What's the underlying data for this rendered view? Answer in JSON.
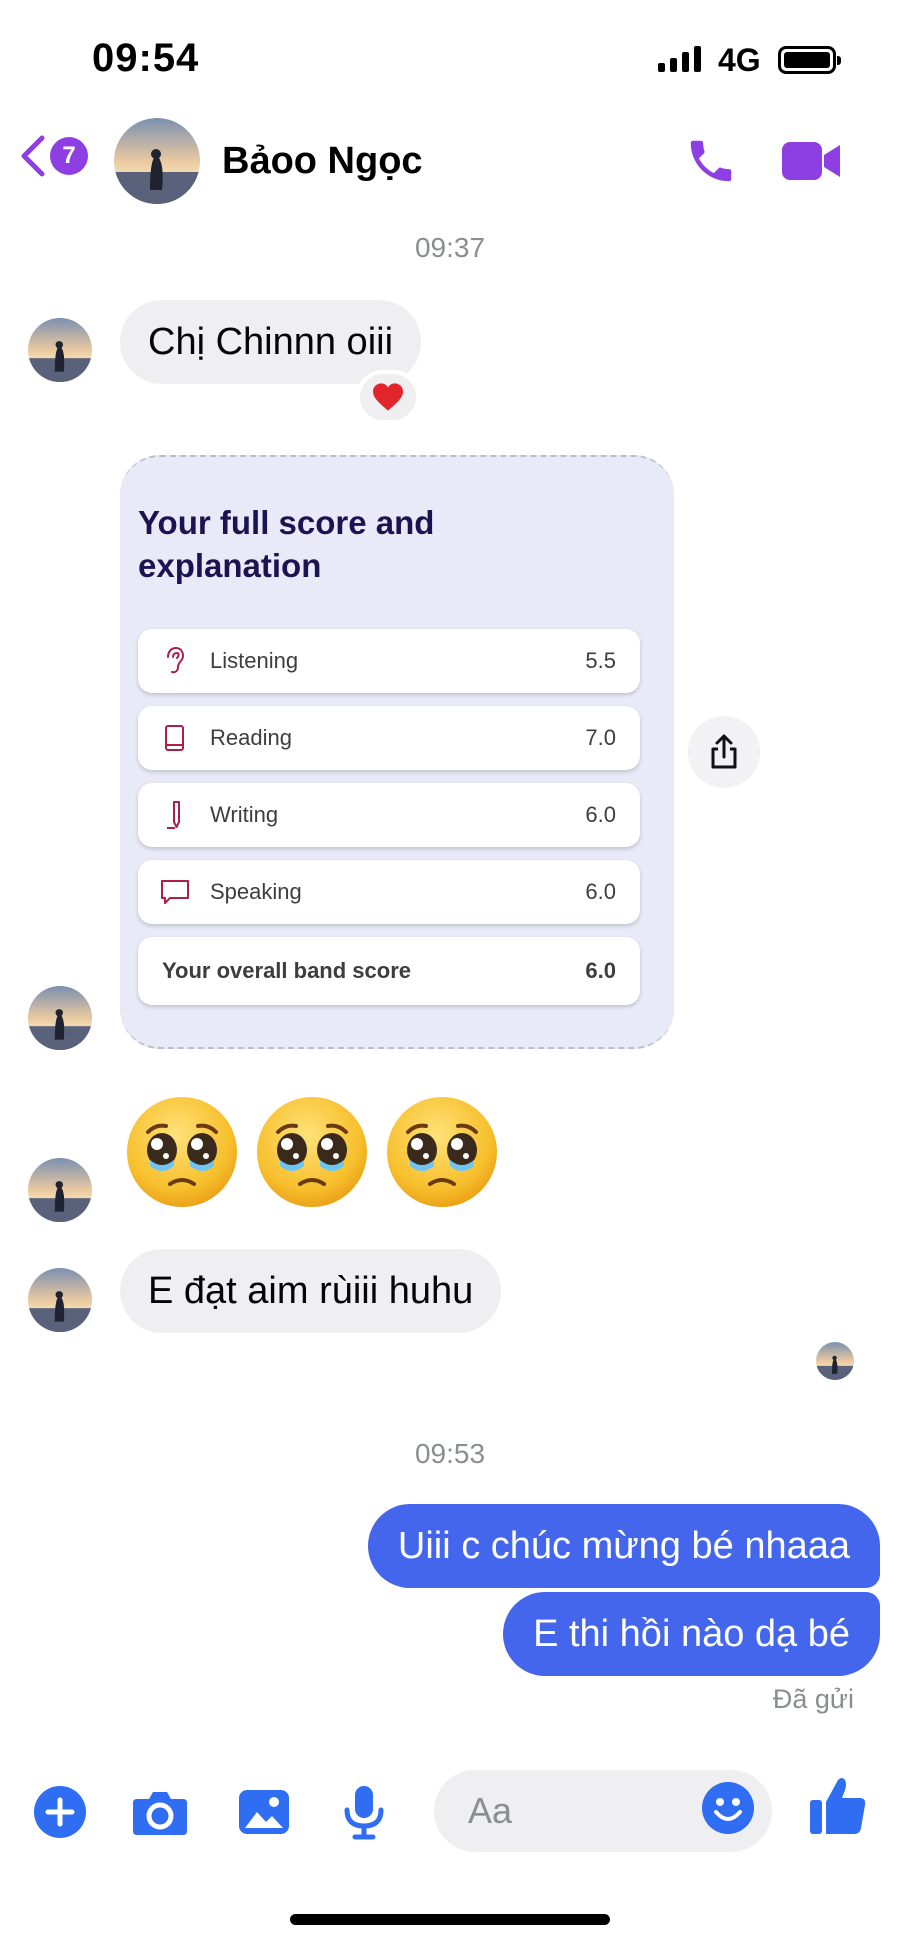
{
  "status_bar": {
    "time": "09:54",
    "network": "4G"
  },
  "header": {
    "back_count": "7",
    "contact_name": "Bảoo Ngọc",
    "icons": {
      "back": "chevron-left-icon",
      "call": "phone-icon",
      "video": "video-camera-icon"
    },
    "accent_color": "#8e3fe3"
  },
  "conversation": {
    "timestamp_1": "09:37",
    "message_1": "Chị Chinnn oiii",
    "reaction_1": "❤️",
    "score_card": {
      "title": "Your full score and explanation",
      "rows": [
        {
          "label": "Listening",
          "value": "5.5",
          "icon": "ear-icon"
        },
        {
          "label": "Reading",
          "value": "7.0",
          "icon": "book-icon"
        },
        {
          "label": "Writing",
          "value": "6.0",
          "icon": "pencil-icon"
        },
        {
          "label": "Speaking",
          "value": "6.0",
          "icon": "speech-bubble-icon"
        }
      ],
      "total": {
        "label": "Your overall band score",
        "value": "6.0"
      }
    },
    "emojis": [
      "🥹",
      "🥹",
      "🥹"
    ],
    "message_2": "E đạt aim rùiii huhu",
    "timestamp_2": "09:53",
    "outgoing": [
      "Uiii c chúc mừng bé nhaaa",
      "E thi hồi nào dạ bé"
    ],
    "sent_status": "Đã gửi",
    "outgoing_color": "#4366ec"
  },
  "composer": {
    "placeholder": "Aa",
    "icons": [
      "plus-icon",
      "camera-icon",
      "image-icon",
      "microphone-icon",
      "emoji-icon",
      "thumbs-up-icon"
    ],
    "icon_color": "#2f6df2"
  }
}
